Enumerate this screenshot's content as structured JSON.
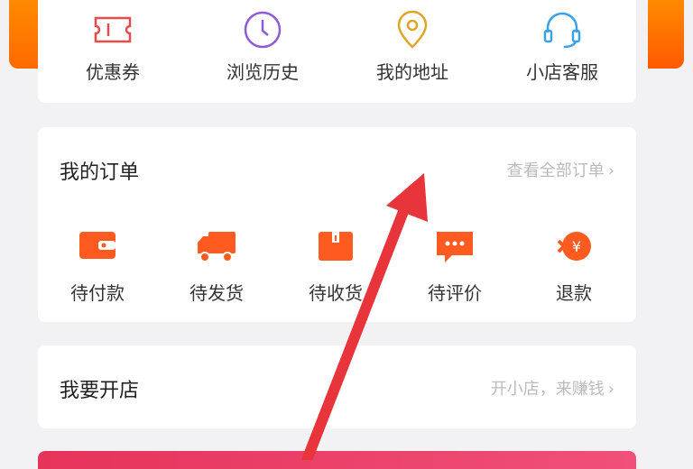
{
  "quick_links": [
    {
      "label": "优惠券",
      "icon": "coupon-icon",
      "color": "#e94b4b"
    },
    {
      "label": "浏览历史",
      "icon": "clock-icon",
      "color": "#8e5bd9"
    },
    {
      "label": "我的地址",
      "icon": "location-pin-icon",
      "color": "#e0a526"
    },
    {
      "label": "小店客服",
      "icon": "headset-icon",
      "color": "#3aa1e8"
    }
  ],
  "orders": {
    "title": "我的订单",
    "view_all": "查看全部订单",
    "items": [
      {
        "label": "待付款",
        "icon": "wallet-icon"
      },
      {
        "label": "待发货",
        "icon": "truck-icon"
      },
      {
        "label": "待收货",
        "icon": "package-icon"
      },
      {
        "label": "待评价",
        "icon": "comment-icon"
      },
      {
        "label": "退款",
        "icon": "refund-icon"
      }
    ],
    "accent": "#ff5a1f"
  },
  "shop": {
    "title": "我要开店",
    "link": "开小店，来赚钱"
  },
  "annotation": {
    "type": "red-arrow",
    "color": "#e8353c"
  }
}
